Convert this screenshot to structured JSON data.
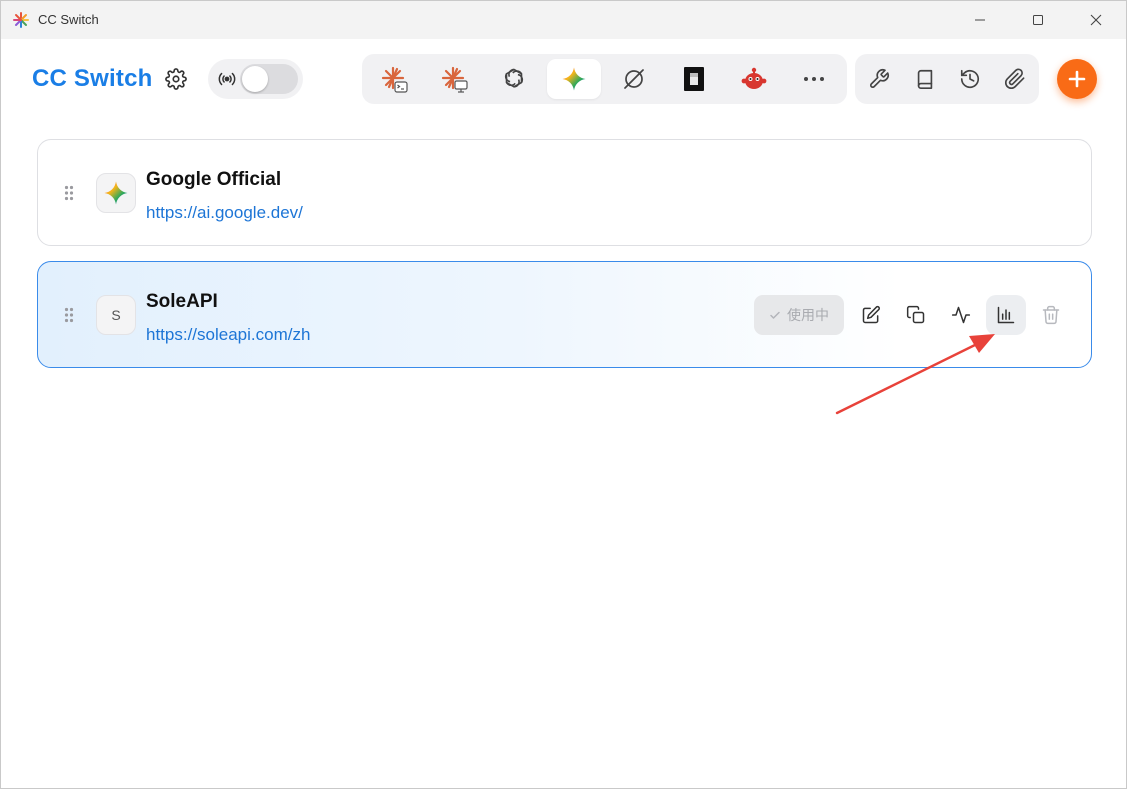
{
  "window": {
    "title": "CC Switch"
  },
  "header": {
    "brand": "CC Switch",
    "proxy_toggle_on": false
  },
  "app_tabs": [
    {
      "name": "claude-code",
      "icon": "claude-terminal-icon",
      "active": false
    },
    {
      "name": "claude-desktop",
      "icon": "claude-desktop-icon",
      "active": false
    },
    {
      "name": "openai-codex",
      "icon": "openai-icon",
      "active": false
    },
    {
      "name": "gemini",
      "icon": "gemini-sparkle-icon",
      "active": true
    },
    {
      "name": "opencode",
      "icon": "orbit-icon",
      "active": false
    },
    {
      "name": "terminal-app",
      "icon": "black-square-icon",
      "active": false
    },
    {
      "name": "red-bot",
      "icon": "red-bot-icon",
      "active": false
    },
    {
      "name": "more",
      "icon": "more-dots-icon",
      "active": false
    }
  ],
  "tools": [
    "wrench-icon",
    "book-icon",
    "history-icon",
    "paperclip-icon"
  ],
  "providers": [
    {
      "name": "Google Official",
      "url": "https://ai.google.dev/",
      "avatar_icon": "gemini-sparkle-icon",
      "active": false
    },
    {
      "name": "SoleAPI",
      "url": "https://soleapi.com/zh",
      "avatar_letter": "S",
      "active": true,
      "in_use_label": "使用中"
    }
  ],
  "colors": {
    "brand_blue": "#1a7ee6",
    "accent_orange": "#f96b16",
    "link_blue": "#1d75d6",
    "active_border": "#3a8bea",
    "annotation_red": "#e8423a"
  }
}
